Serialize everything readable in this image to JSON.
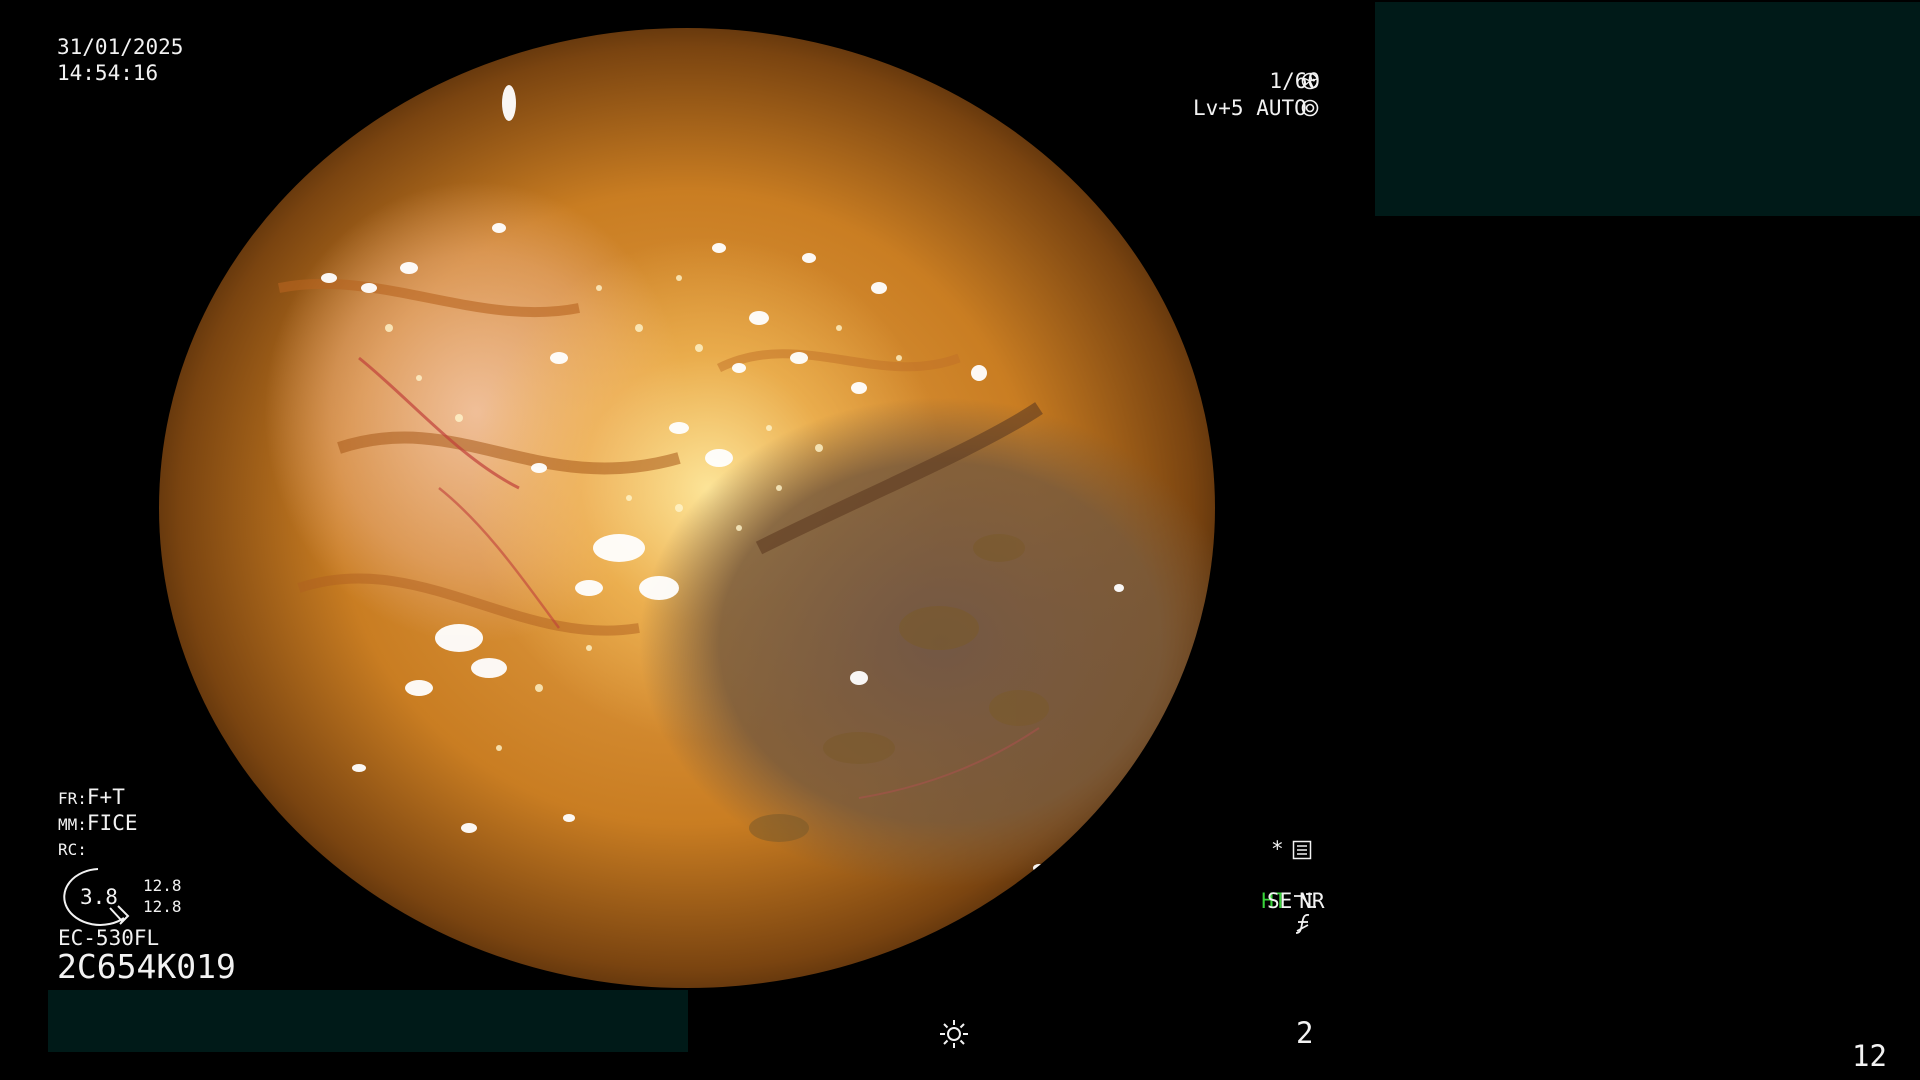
{
  "overlay": {
    "date": "31/01/2025",
    "time": "14:54:16",
    "shutter": "1/60",
    "level_mode": "Lv+5 AUTO",
    "fr": {
      "label": "FR:",
      "value": "F+T"
    },
    "mm": {
      "label": "MM:",
      "value": "FICE"
    },
    "rc": {
      "label": "RC:"
    },
    "gauge_value": "3.8",
    "gauge_right_top": "12.8",
    "gauge_right_bottom": "12.8",
    "scope_model": "EC-530FL",
    "serial": "2C654K019",
    "star": "*",
    "ht": "HT",
    "nr": "NR",
    "se": "SE",
    "bottom_center_number": "2",
    "bottom_right_number": "12"
  },
  "icons": {
    "shutter": "aperture-icon",
    "auto": "iris-icon",
    "memo": "memo-icon",
    "se": "enhancement-curve-icon",
    "f": "function-icon",
    "light": "sun-icon"
  },
  "colors": {
    "background": "#000000",
    "panel": "#001a18",
    "text": "#f2f2f2",
    "ht": "#39d33a"
  }
}
